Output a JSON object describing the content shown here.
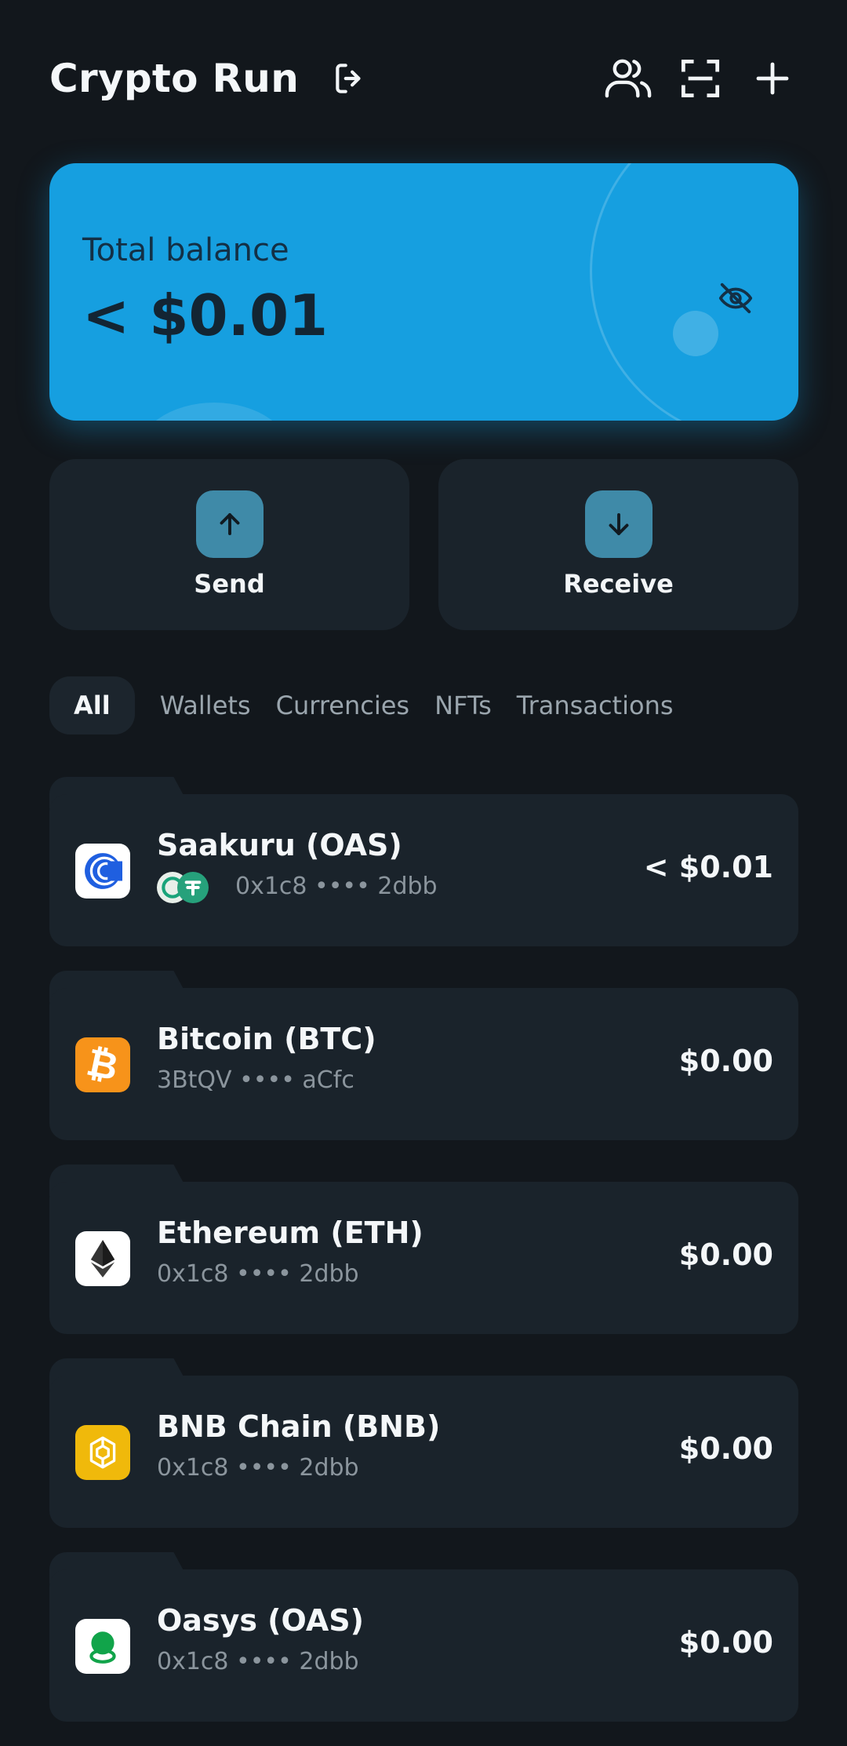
{
  "header": {
    "title": "Crypto Run",
    "icons": [
      "logout-icon",
      "contacts-icon",
      "scan-icon",
      "add-icon"
    ]
  },
  "balance": {
    "label": "Total balance",
    "value": "< $0.01",
    "hide_icon": "eye-off-icon"
  },
  "actions": [
    {
      "label": "Send",
      "icon": "arrow-up-icon"
    },
    {
      "label": "Receive",
      "icon": "arrow-down-icon"
    }
  ],
  "tabs": [
    {
      "label": "All",
      "active": true
    },
    {
      "label": "Wallets"
    },
    {
      "label": "Currencies"
    },
    {
      "label": "NFTs"
    },
    {
      "label": "Transactions"
    }
  ],
  "assets": [
    {
      "name": "Saakuru (OAS)",
      "address": "0x1c8 •••• 2dbb",
      "value": "< $0.01",
      "logo": "saakuru-logo-icon",
      "logo_bg": "#ffffff"
    },
    {
      "name": "Bitcoin (BTC)",
      "address": "3BtQV •••• aCfc",
      "value": "$0.00",
      "logo": "bitcoin-logo-icon",
      "logo_bg": "#f7931a"
    },
    {
      "name": "Ethereum (ETH)",
      "address": "0x1c8 •••• 2dbb",
      "value": "$0.00",
      "logo": "ethereum-logo-icon",
      "logo_bg": "#ffffff"
    },
    {
      "name": "BNB Chain (BNB)",
      "address": "0x1c8 •••• 2dbb",
      "value": "$0.00",
      "logo": "bnb-logo-icon",
      "logo_bg": "#f0b90b"
    },
    {
      "name": "Oasys (OAS)",
      "address": "0x1c8 •••• 2dbb",
      "value": "$0.00",
      "logo": "oasys-logo-icon",
      "logo_bg": "#ffffff"
    }
  ],
  "colors": {
    "background": "#12171c",
    "card": "#1a232b",
    "accent": "#169fe0",
    "action_icon_bg": "#3f8aa8",
    "muted_text": "#8b959d"
  }
}
